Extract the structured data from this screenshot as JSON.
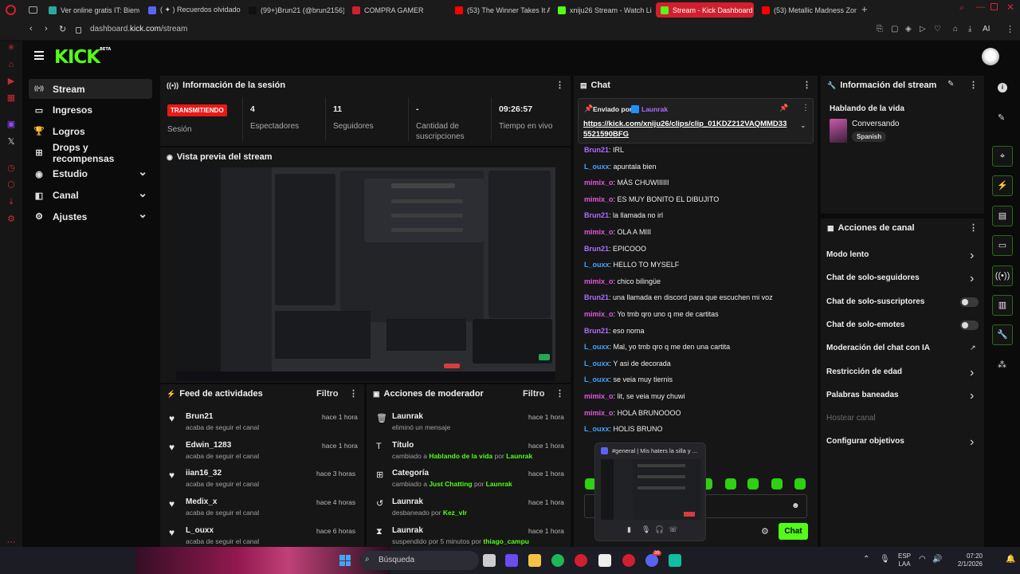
{
  "browser": {
    "tabs": [
      {
        "label": "Ver online gratis IT: Bienve",
        "color": "#2aa8a0"
      },
      {
        "label": "( ✦ ) Recuerdos olvidados",
        "color": "#5865f2"
      },
      {
        "label": "(99+)Brun21 (@brun2156)",
        "color": "#111111"
      },
      {
        "label": "COMPRA GAMER",
        "color": "#d0202f"
      },
      {
        "label": "(53) The Winner Takes It A",
        "color": "#ff0000"
      },
      {
        "label": "xniju26 Stream - Watch Li",
        "color": "#53fc18"
      },
      {
        "label": "Stream - Kick Dashboard",
        "color": "#53fc18"
      },
      {
        "label": "(53) Metallic Madness Zon",
        "color": "#ff0000"
      }
    ],
    "active_tab_index": 6,
    "url_prefix": "dashboard.",
    "url_domain": "kick.com",
    "url_path": "/stream",
    "ai_label": "AI"
  },
  "header": {
    "logo": "KICK",
    "logo_badge": "BETA"
  },
  "nav": {
    "items": [
      {
        "label": "Stream",
        "icon": "broadcast-icon",
        "glyph": "((•))",
        "active": true
      },
      {
        "label": "Ingresos",
        "icon": "wallet-icon",
        "glyph": "▭"
      },
      {
        "label": "Logros",
        "icon": "trophy-icon",
        "glyph": "🏆"
      },
      {
        "label": "Drops y recompensas",
        "icon": "gift-icon",
        "glyph": "⊞"
      },
      {
        "label": "Estudio",
        "icon": "studio-icon",
        "glyph": "◉",
        "expandable": true
      },
      {
        "label": "Canal",
        "icon": "channel-icon",
        "glyph": "◧",
        "expandable": true
      },
      {
        "label": "Ajustes",
        "icon": "settings-icon",
        "glyph": "⚙",
        "expandable": true
      }
    ]
  },
  "session": {
    "title": "Información de la sesión",
    "live_badge": "TRANSMITIENDO",
    "live_label": "Sesión",
    "stats": [
      {
        "value": "4",
        "label": "Espectadores"
      },
      {
        "value": "11",
        "label": "Seguidores"
      },
      {
        "value": "-",
        "label": "Cantidad de suscripciones"
      },
      {
        "value": "09:26:57",
        "label": "Tiempo en vivo"
      }
    ]
  },
  "preview": {
    "title": "Vista previa del stream"
  },
  "activity": {
    "title": "Feed de actividades",
    "filter": "Filtro",
    "items": [
      {
        "name": "Brun21",
        "sub": "acaba de seguir el canal",
        "time": "hace 1 hora"
      },
      {
        "name": "Edwin_1283",
        "sub": "acaba de seguir el canal",
        "time": "hace 1 hora"
      },
      {
        "name": "iian16_32",
        "sub": "acaba de seguir el canal",
        "time": "hace 3 horas"
      },
      {
        "name": "Medix_x",
        "sub": "acaba de seguir el canal",
        "time": "hace 4 horas"
      },
      {
        "name": "L_ouxx",
        "sub": "acaba de seguir el canal",
        "time": "hace 6 horas"
      }
    ]
  },
  "modactions": {
    "title": "Acciones de moderador",
    "filter": "Filtro",
    "items": [
      {
        "icon": "trash-icon",
        "glyph": "🗑",
        "name": "Launrak",
        "pre": "eliminó un mensaje",
        "hl": "",
        "mid": "",
        "by": "",
        "time": "hace 1 hora"
      },
      {
        "icon": "title-icon",
        "glyph": "T",
        "name": "Título",
        "pre": "cambiado a ",
        "hl": "Hablando de la vida",
        "mid": " por ",
        "by": "Launrak",
        "time": "hace 1 hora"
      },
      {
        "icon": "category-icon",
        "glyph": "⊞",
        "name": "Categoría",
        "pre": "cambiado a ",
        "hl": "Just Chatting",
        "mid": " por ",
        "by": "Launrak",
        "time": "hace 1 hora"
      },
      {
        "icon": "unban-icon",
        "glyph": "↺",
        "name": "Launrak",
        "pre": "desbaneado por ",
        "hl": "Kez_vlr",
        "mid": "",
        "by": "",
        "time": "hace 1 hora"
      },
      {
        "icon": "timeout-icon",
        "glyph": "⧗",
        "name": "Launrak",
        "pre": "suspendido por 5 minutos por ",
        "hl": "thiago_campu",
        "mid": "",
        "by": "",
        "time": "hace 1 hora"
      }
    ]
  },
  "chat": {
    "title": "Chat",
    "pinned_by_label": "Enviado por",
    "pinned_by": "Launrak",
    "pinned_link": "https://kick.com/xniju26/clips/clip_01KDZ212VAQMMD33 5521590BFG",
    "messages": [
      {
        "user": "Brun21",
        "color": "#a970ff",
        "text": ": IRL"
      },
      {
        "user": "L_ouxx",
        "color": "#3ea6ff",
        "text": ": apuntala bien"
      },
      {
        "user": "mimix_o",
        "color": "#e05ad8",
        "text": ": MÁS CHUWIIIIII"
      },
      {
        "user": "mimix_o",
        "color": "#e05ad8",
        "text": ": ES MUY BONITO EL DIBUJITO"
      },
      {
        "user": "Brun21",
        "color": "#a970ff",
        "text": ": la llamada no irl"
      },
      {
        "user": "mimix_o",
        "color": "#e05ad8",
        "text": ": OLA A MIII"
      },
      {
        "user": "Brun21",
        "color": "#a970ff",
        "text": ": EPICOOO"
      },
      {
        "user": "L_ouxx",
        "color": "#3ea6ff",
        "text": ": HELLO TO MYSELF"
      },
      {
        "user": "mimix_o",
        "color": "#e05ad8",
        "text": ": chico bilingüe"
      },
      {
        "user": "Brun21",
        "color": "#a970ff",
        "text": ": una llamada en discord para que escuchen mi voz"
      },
      {
        "user": "mimix_o",
        "color": "#e05ad8",
        "text": ": Yo tmb qro uno q me de cartitas"
      },
      {
        "user": "Brun21",
        "color": "#a970ff",
        "text": ": eso noma"
      },
      {
        "user": "L_ouxx",
        "color": "#3ea6ff",
        "text": ": Mal, yo tmb qro q me den una cartita"
      },
      {
        "user": "L_ouxx",
        "color": "#3ea6ff",
        "text": ": Y asi de decorada"
      },
      {
        "user": "L_ouxx",
        "color": "#3ea6ff",
        "text": ": se veia muy tiernis"
      },
      {
        "user": "mimix_o",
        "color": "#e05ad8",
        "text": ": lit, se veia muy chuwi"
      },
      {
        "user": "mimix_o",
        "color": "#e05ad8",
        "text": ": HOLA BRUNOOOO"
      },
      {
        "user": "L_ouxx",
        "color": "#3ea6ff",
        "text": ": HOLIS BRUNO"
      }
    ],
    "send_label": "Chat",
    "popup_title": "#general | Mis haters la silla y ..."
  },
  "streaminfo": {
    "title": "Información del stream",
    "stream_title": "Hablando de la vida",
    "category": "Conversando",
    "language": "Spanish"
  },
  "channelactions": {
    "title": "Acciones de canal",
    "items": [
      {
        "label": "Modo lento",
        "kind": "chevron"
      },
      {
        "label": "Chat de solo-seguidores",
        "kind": "chevron"
      },
      {
        "label": "Chat de solo-suscriptores",
        "kind": "toggle"
      },
      {
        "label": "Chat de solo-emotes",
        "kind": "toggle"
      },
      {
        "label": "Moderación del chat con IA",
        "kind": "external"
      },
      {
        "label": "Restricción de edad",
        "kind": "chevron"
      },
      {
        "label": "Palabras baneadas",
        "kind": "chevron"
      },
      {
        "label": "Hostear canal",
        "kind": "disabled"
      },
      {
        "label": "Configurar objetivos",
        "kind": "chevron"
      }
    ]
  },
  "taskbar": {
    "search_label": "Búsqueda",
    "lang": "ESP",
    "lang2": "LAA",
    "time": "07:20",
    "date": "2/1/2026",
    "discord_badge": "39"
  },
  "colors": {
    "accent": "#53fc18",
    "live": "#e91916",
    "panel": "#161616"
  }
}
